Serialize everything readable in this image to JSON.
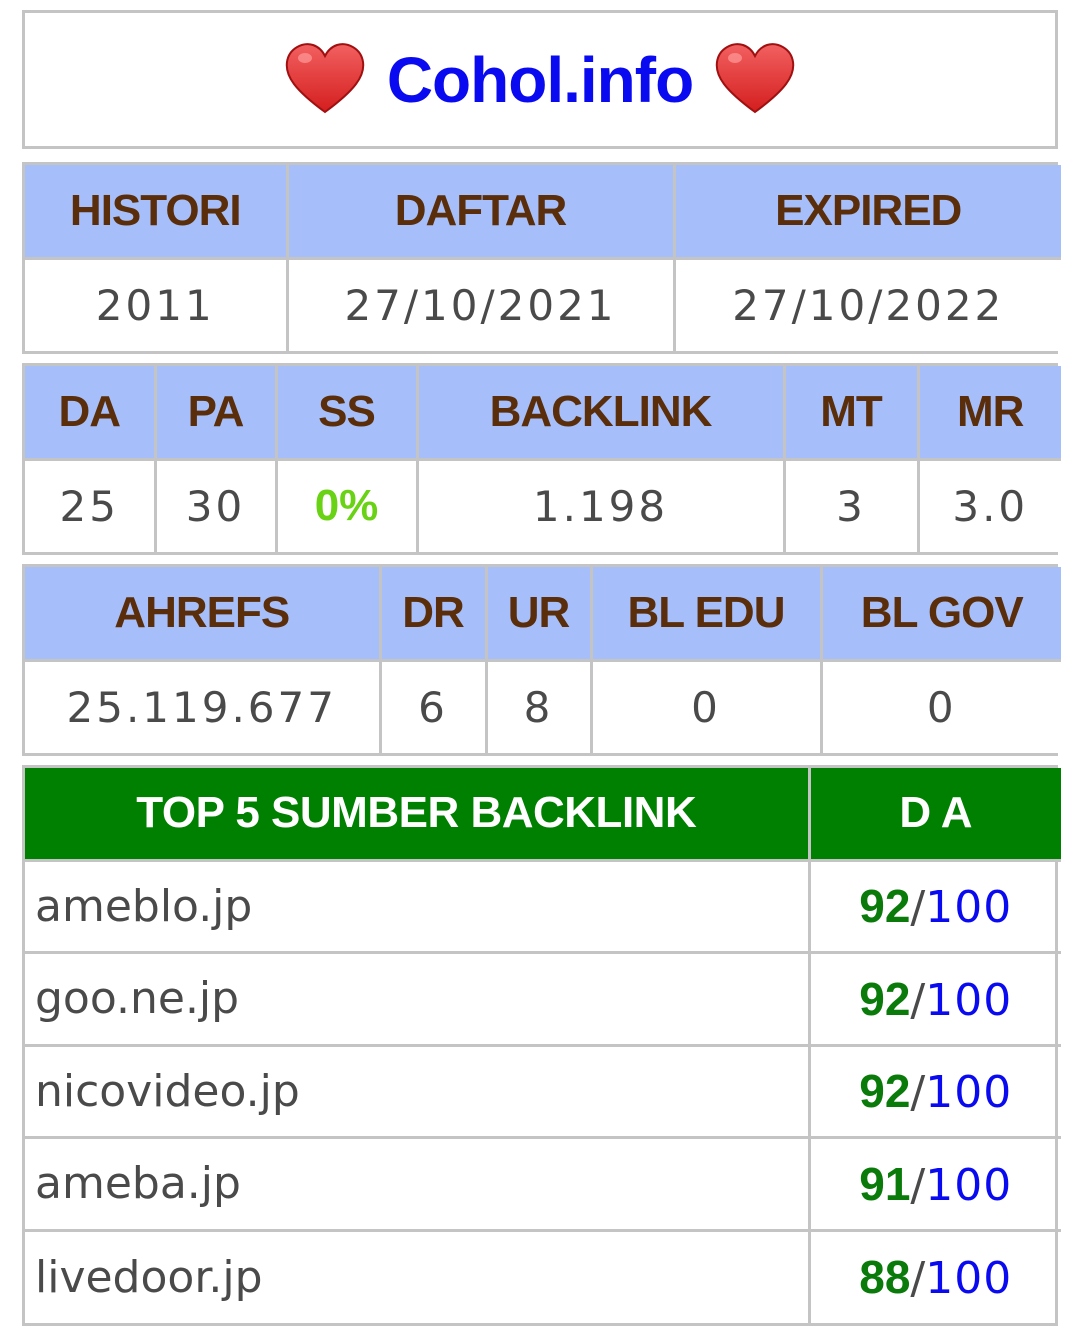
{
  "site": {
    "name": "Cohol.info",
    "heart_icon": "heart-icon"
  },
  "dates": {
    "headers": [
      "HISTORI",
      "DAFTAR",
      "EXPIRED"
    ],
    "values": [
      "2011",
      "27/10/2021",
      "27/10/2022"
    ]
  },
  "moz": {
    "headers": [
      "DA",
      "PA",
      "SS",
      "BACKLINK",
      "MT",
      "MR"
    ],
    "values": [
      "25",
      "30",
      "0%",
      "1.198",
      "3",
      "3.0"
    ]
  },
  "ahrefs": {
    "headers": [
      "AHREFS",
      "DR",
      "UR",
      "BL EDU",
      "BL GOV"
    ],
    "values": [
      "25.119.677",
      "6",
      "8",
      "0",
      "0"
    ]
  },
  "top_backlinks": {
    "header_source": "TOP 5 SUMBER BACKLINK",
    "header_da": "D A",
    "separator": "/",
    "max": "100",
    "rows": [
      {
        "site": "ameblo.jp",
        "da": "92"
      },
      {
        "site": "goo.ne.jp",
        "da": "92"
      },
      {
        "site": "nicovideo.jp",
        "da": "92"
      },
      {
        "site": "ameba.jp",
        "da": "91"
      },
      {
        "site": "livedoor.jp",
        "da": "88"
      }
    ]
  },
  "colors": {
    "header_bg": "#a6bffb",
    "header_text": "#5a2e0a",
    "title": "#0a0af0",
    "green_header": "#008000",
    "ss_value": "#6ad214",
    "da_value": "#0a7a0a"
  }
}
